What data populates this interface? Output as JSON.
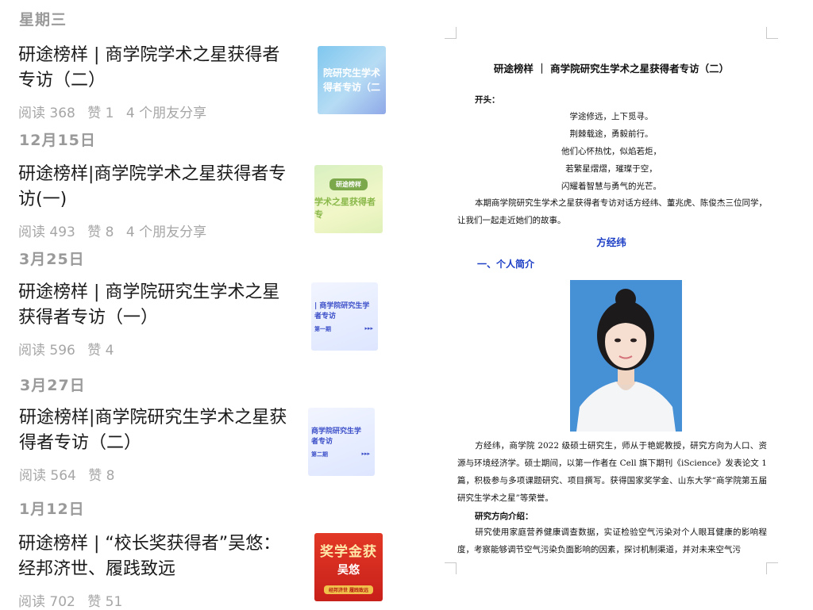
{
  "feed": {
    "groups": [
      {
        "date": "星期三",
        "article": {
          "title_line1": "研途榜样 | 商学院学术之星获得者",
          "title_line2": "专访（二）",
          "meta": [
            "阅读 368",
            "赞 1",
            "4 个朋友分享"
          ],
          "thumb": {
            "line1": "院研究生学术",
            "line2": "得者专访（二"
          }
        }
      },
      {
        "date": "12月15日",
        "article": {
          "title_line1": "研途榜样|商学院学术之星获得者专",
          "title_line2": "访(一)",
          "meta": [
            "阅读 493",
            "赞 8",
            "4 个朋友分享"
          ],
          "thumb": {
            "line1": "研途榜样",
            "line2": "学术之星获得者专"
          }
        }
      },
      {
        "date": "3月25日",
        "article": {
          "title_line1": "研途榜样 | 商学院研究生学术之星",
          "title_line2": "获得者专访（一）",
          "meta": [
            "阅读 596",
            "赞 4"
          ],
          "thumb": {
            "line1": "| 商学院研究生学",
            "line2": "者专访",
            "line3": "第一期",
            "arrows": "▸▸▸"
          }
        }
      },
      {
        "date": "3月27日",
        "article": {
          "title_line1": "研途榜样|商学院研究生学术之星获",
          "title_line2": "得者专访（二）",
          "meta": [
            "阅读 564",
            "赞 8"
          ],
          "thumb": {
            "line1": "商学院研究生学",
            "line2": "者专访",
            "line3": "第二期",
            "arrows": "▸▸▸"
          }
        }
      },
      {
        "date": "1月12日",
        "article": {
          "title_line1": "研途榜样 | “校长奖获得者”吴悠：",
          "title_line2": "经邦济世、履践致远",
          "meta": [
            "阅读 702",
            "赞 51"
          ],
          "thumb": {
            "line1": "奖学金获",
            "line2": "吴悠",
            "line3": "经邦济世 履践致远"
          }
        }
      }
    ]
  },
  "doc": {
    "title": "研途榜样 ｜ 商学院研究生学术之星获得者专访（二）",
    "intro_label": "开头：",
    "poem": [
      "学途修远，上下觅寻。",
      "荆棘载途，勇毅前行。",
      "他们心怀热忱，似焰若炬，",
      "若繁星熠熠，璀璨于空，",
      "闪耀着智慧与勇气的光芒。"
    ],
    "intro_para": "本期商学院研究生学术之星获得者专访对话方经纬、董兆虎、陈俊杰三位同学，让我们一起走近她们的故事。",
    "person_name": "方经纬",
    "section_heading": "一、个人简介",
    "bio_para": "方经纬，商学院 2022 级硕士研究生，师从于艳妮教授，研究方向为人口、资源与环境经济学。硕士期间，以第一作者在 Cell 旗下期刊《iScience》发表论文 1 篇，积极参与多项课题研究、项目撰写。获得国家奖学金、山东大学“商学院第五届研究生学术之星”等荣誉。",
    "research_label": "研究方向介绍：",
    "research_para": "研究使用家庭营养健康调查数据，实证检验空气污染对个人眼耳健康的影响程度，考察能够调节空气污染负面影响的因素，探讨机制渠道，并对未来空气污"
  }
}
